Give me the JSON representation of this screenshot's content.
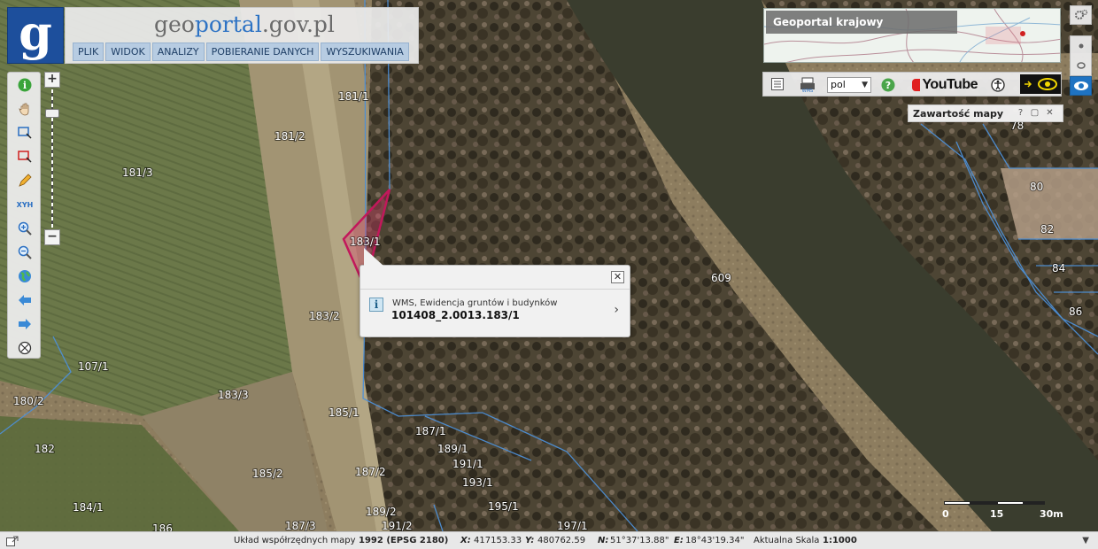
{
  "header": {
    "logo_letter": "g",
    "title_part1": "geo",
    "title_part2": "portal",
    "title_part3": ".gov.pl",
    "menu": [
      "PLIK",
      "WIDOK",
      "ANALIZY",
      "POBIERANIE DANYCH",
      "WYSZUKIWANIA"
    ]
  },
  "toolbar": {
    "xyh_label": "XYH",
    "zoom_in": "+",
    "zoom_out": "−"
  },
  "overview": {
    "title": "Geoportal krajowy"
  },
  "right_toolbar": {
    "language": "pol",
    "help": "?",
    "youtube_label": "YouTube"
  },
  "content_panel": {
    "title": "Zawartość mapy",
    "help": "?"
  },
  "popup": {
    "layer": "WMS, Ewidencja gruntów i budynków",
    "parcel": "101408_2.0013.183/1",
    "close": "✕"
  },
  "parcels": [
    "181/1",
    "181/2",
    "181/3",
    "183/1",
    "183/2",
    "183/3",
    "107/1",
    "180/2",
    "182",
    "185/1",
    "185/2",
    "187/1",
    "187/2",
    "187/3",
    "189/1",
    "189/2",
    "191/1",
    "191/2",
    "193/1",
    "195/1",
    "197/1",
    "184/1",
    "186",
    "609",
    "78",
    "80",
    "82",
    "84",
    "86"
  ],
  "scale_bar": {
    "labels": [
      "0",
      "15",
      "30m"
    ]
  },
  "status": {
    "crs_label": "Układ współrzędnych mapy",
    "crs_value": "1992 (EPSG 2180)",
    "x_label": "X:",
    "x_value": "417153.33",
    "y_label": "Y:",
    "y_value": "480762.59",
    "n_label": "N:",
    "n_value": "51°37'13.88\"",
    "e_label": "E:",
    "e_value": "18°43'19.34\"",
    "scale_label": "Aktualna Skala",
    "scale_value": "1:1000"
  },
  "colors": {
    "logo_blue": "#1d4f9c",
    "menu_bg": "#b7cce2",
    "parcel_line": "#4d8fd6",
    "selection": "#c2185b",
    "river": "#3a3d2e"
  }
}
